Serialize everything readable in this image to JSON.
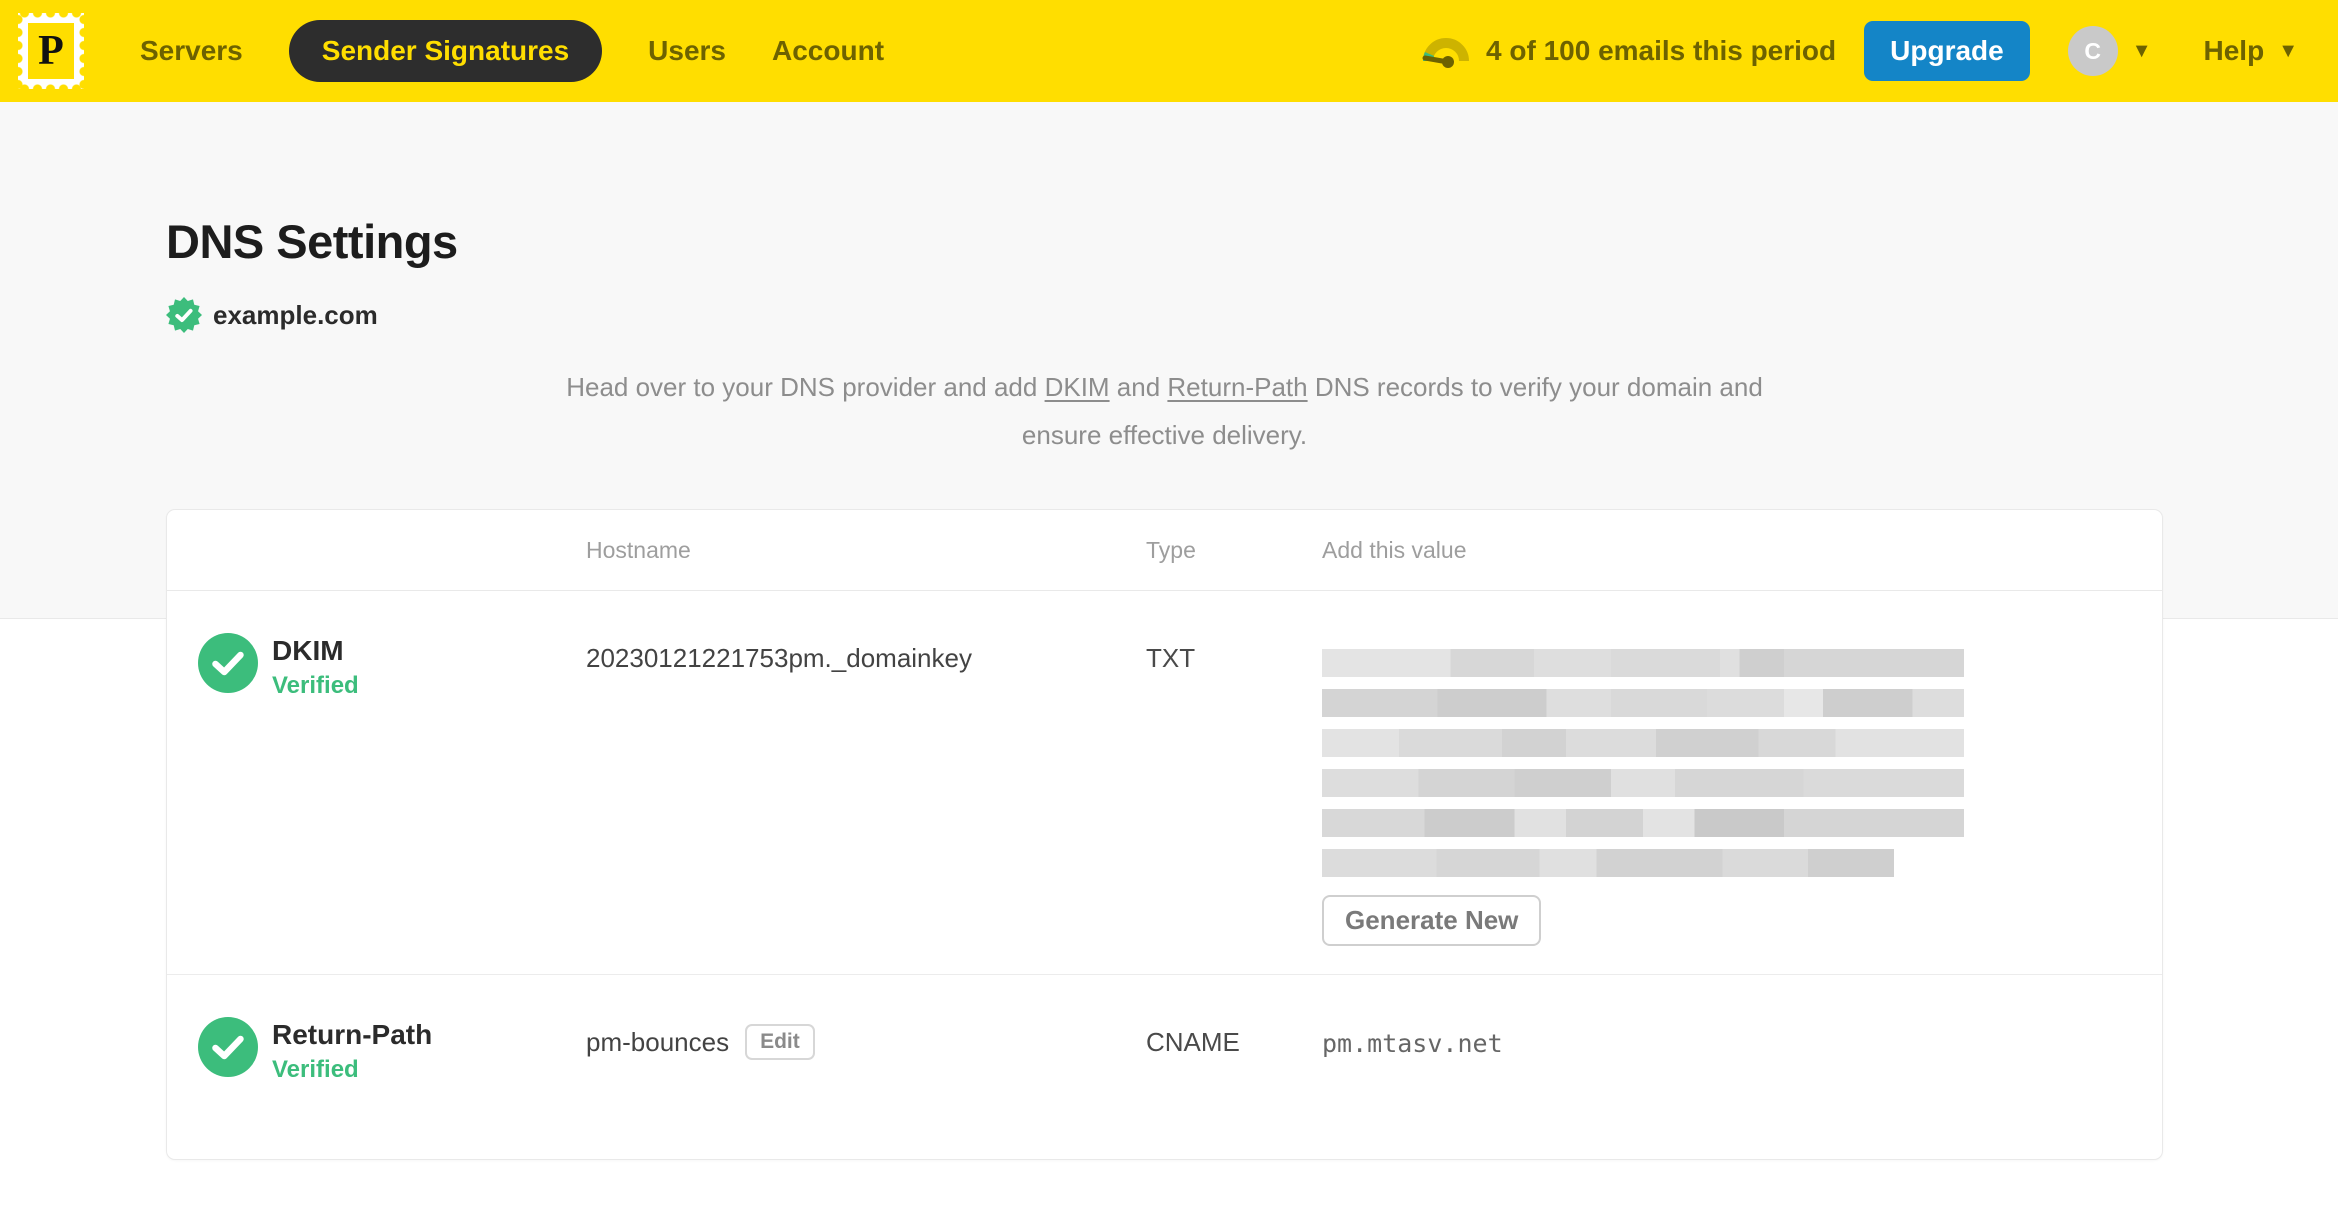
{
  "navbar": {
    "logo_letter": "P",
    "items": [
      {
        "label": "Servers"
      },
      {
        "label": "Sender Signatures"
      },
      {
        "label": "Users"
      },
      {
        "label": "Account"
      }
    ],
    "usage_text": "4 of 100 emails this period",
    "upgrade_label": "Upgrade",
    "avatar_initial": "C",
    "help_label": "Help"
  },
  "page": {
    "title": "DNS Settings",
    "domain": "example.com",
    "description": {
      "part1": "Head over to your DNS provider and add ",
      "link_dkim": "DKIM",
      "part2": " and ",
      "link_return_path": "Return-Path",
      "part3": " DNS records to verify your domain and ensure effective delivery."
    }
  },
  "table": {
    "headers": {
      "hostname": "Hostname",
      "type": "Type",
      "value": "Add this value"
    },
    "rows": [
      {
        "name": "DKIM",
        "status": "Verified",
        "hostname": "20230121221753pm._domainkey",
        "type": "TXT",
        "value": "(redacted)",
        "action_label": "Generate New"
      },
      {
        "name": "Return-Path",
        "status": "Verified",
        "hostname": "pm-bounces",
        "edit_label": "Edit",
        "type": "CNAME",
        "value": "pm.mtasv.net"
      }
    ]
  },
  "colors": {
    "brand_yellow": "#ffde00",
    "nav_text_olive": "#6d6200",
    "active_pill_dark": "#2d2d2d",
    "upgrade_blue": "#1485c7",
    "verified_green": "#3cbd7c",
    "page_bg_gray": "#f8f8f8"
  }
}
